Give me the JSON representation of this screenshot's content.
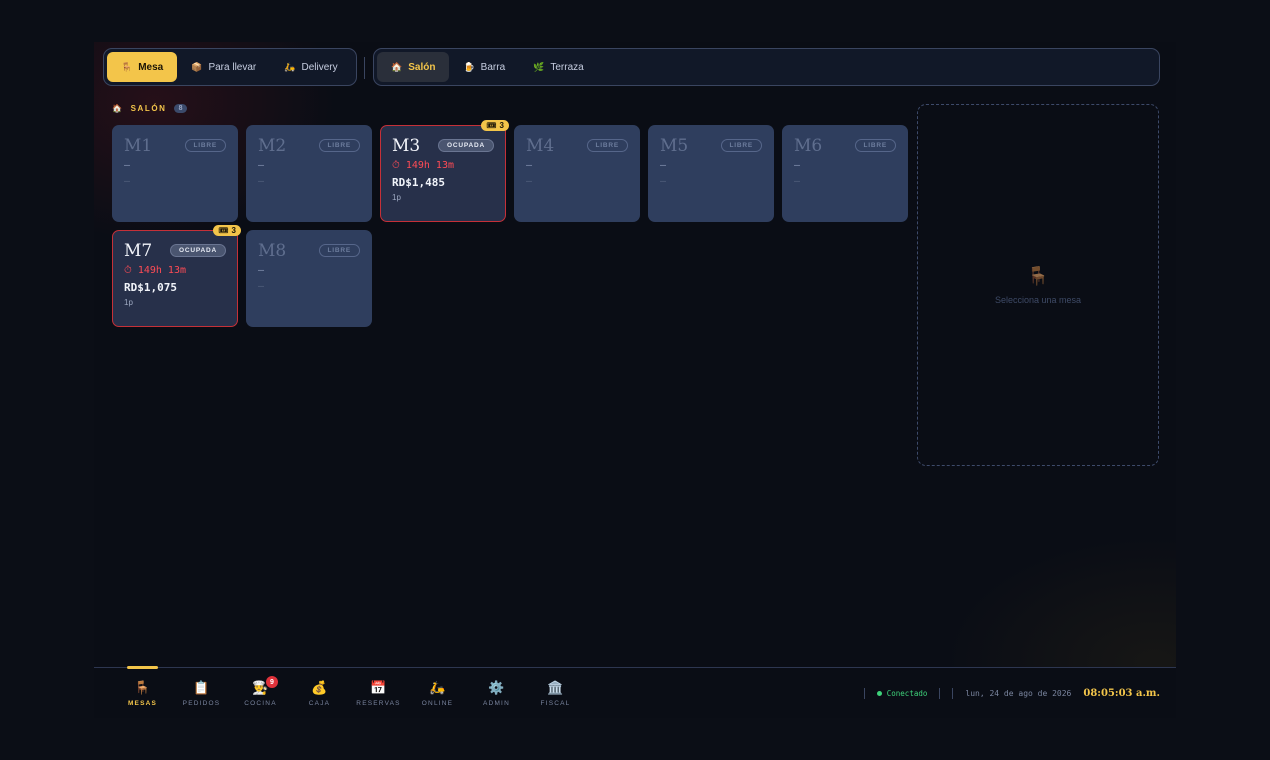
{
  "order_types": [
    {
      "icon": "chair-icon",
      "glyph": "🪑",
      "label": "Mesa",
      "active": true
    },
    {
      "icon": "package-icon",
      "glyph": "📦",
      "label": "Para llevar",
      "active": false
    },
    {
      "icon": "scooter-icon",
      "glyph": "🛵",
      "label": "Delivery",
      "active": false
    }
  ],
  "zones": [
    {
      "icon": "house-icon",
      "glyph": "🏠",
      "label": "Salón",
      "active": true
    },
    {
      "icon": "beer-icon",
      "glyph": "🍺",
      "label": "Barra",
      "active": false
    },
    {
      "icon": "plant-icon",
      "glyph": "🌿",
      "label": "Terraza",
      "active": false
    }
  ],
  "section": {
    "title": "SALÓN",
    "count": "8"
  },
  "tables": [
    {
      "name": "M1",
      "status": "LIBRE",
      "line1": "—",
      "line2": "—"
    },
    {
      "name": "M2",
      "status": "LIBRE",
      "line1": "—",
      "line2": "—"
    },
    {
      "name": "M3",
      "status": "OCUPADA",
      "time": "⏱ 149h 13m",
      "amount": "RD$1,485",
      "people": "1p",
      "badge": "3"
    },
    {
      "name": "M4",
      "status": "LIBRE",
      "line1": "—",
      "line2": "—"
    },
    {
      "name": "M5",
      "status": "LIBRE",
      "line1": "—",
      "line2": "—"
    },
    {
      "name": "M6",
      "status": "LIBRE",
      "line1": "—",
      "line2": "—"
    },
    {
      "name": "M7",
      "status": "OCUPADA",
      "time": "⏱ 149h 13m",
      "amount": "RD$1,075",
      "people": "1p",
      "badge": "3"
    },
    {
      "name": "M8",
      "status": "LIBRE",
      "line1": "—",
      "line2": "—"
    }
  ],
  "detail": {
    "hint": "Selecciona una mesa"
  },
  "nav": [
    {
      "icon": "chair-icon",
      "glyph": "🪑",
      "label": "MESAS",
      "active": true
    },
    {
      "icon": "clipboard-icon",
      "glyph": "📋",
      "label": "PEDIDOS"
    },
    {
      "icon": "chef-icon",
      "glyph": "👨‍🍳",
      "label": "COCINA",
      "badge": "9"
    },
    {
      "icon": "money-bag-icon",
      "glyph": "💰",
      "label": "CAJA"
    },
    {
      "icon": "calendar-icon",
      "glyph": "📅",
      "label": "RESERVAS"
    },
    {
      "icon": "scooter-icon",
      "glyph": "🛵",
      "label": "ONLINE"
    },
    {
      "icon": "gear-icon",
      "glyph": "⚙️",
      "label": "ADMIN"
    },
    {
      "icon": "bank-icon",
      "glyph": "🏛️",
      "label": "FISCAL"
    }
  ],
  "status": {
    "connection": "Conectado",
    "date": "lun, 24 de ago de 2026",
    "time": "08:05:03 a.m."
  },
  "colors": {
    "accent": "#f3c54a",
    "danger": "#c53038",
    "ok": "#3ed27a"
  }
}
